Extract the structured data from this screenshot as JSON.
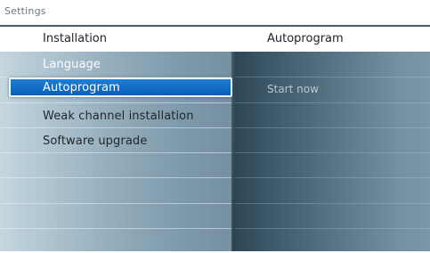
{
  "window": {
    "title": "Settings"
  },
  "left_column": {
    "header": "Installation",
    "items": [
      {
        "label": "Language"
      },
      {
        "label": "Autoprogram"
      },
      {
        "label": "Weak channel installation"
      },
      {
        "label": "Software upgrade"
      }
    ],
    "selected_index": 1
  },
  "right_column": {
    "header": "Autoprogram",
    "action": "Start now"
  },
  "colors": {
    "highlight": "#0d63bd",
    "highlight_border": "#eef6ff",
    "rule": "#4d5b66"
  }
}
